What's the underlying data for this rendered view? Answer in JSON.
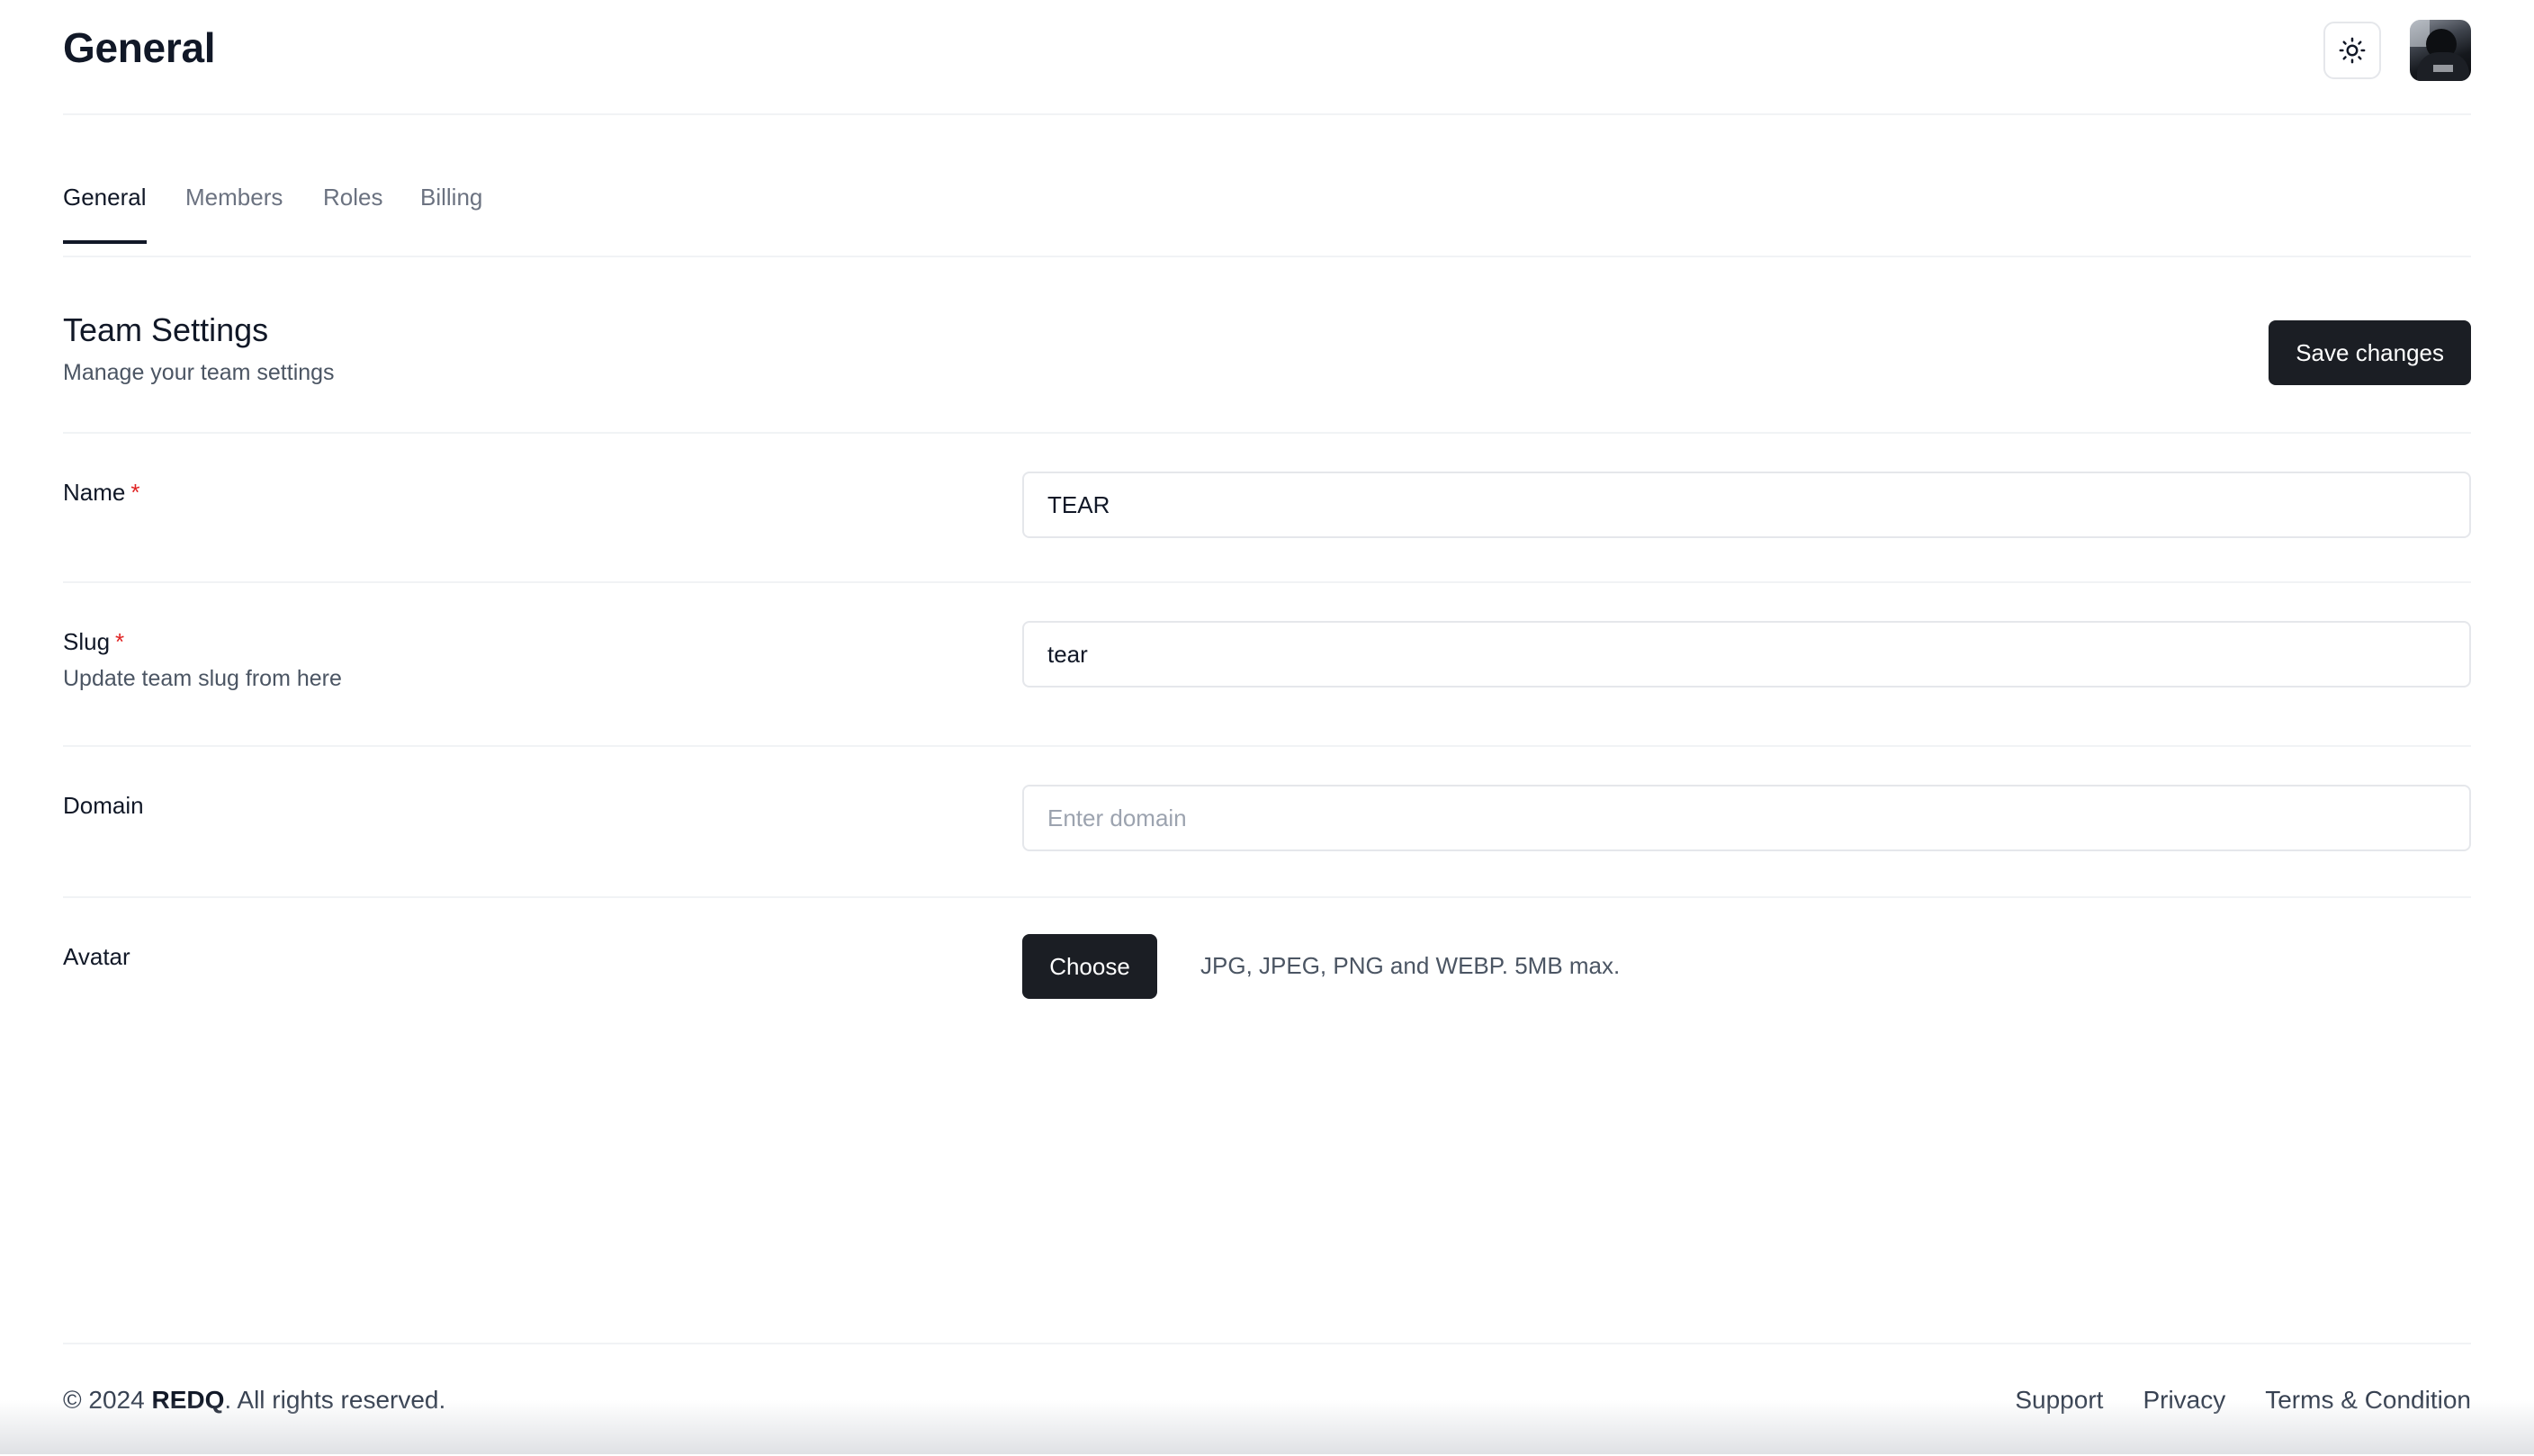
{
  "header": {
    "title": "General",
    "theme_toggle_icon": "sun-icon",
    "avatar_icon": "user-avatar"
  },
  "tabs": [
    {
      "label": "General",
      "active": true
    },
    {
      "label": "Members",
      "active": false
    },
    {
      "label": "Roles",
      "active": false
    },
    {
      "label": "Billing",
      "active": false
    }
  ],
  "section": {
    "title": "Team Settings",
    "subtitle": "Manage your team settings",
    "save_label": "Save changes"
  },
  "form": {
    "name": {
      "label": "Name",
      "required_mark": "*",
      "value": "TEAR",
      "placeholder": ""
    },
    "slug": {
      "label": "Slug",
      "required_mark": "*",
      "help": "Update team slug from here",
      "value": "tear",
      "placeholder": ""
    },
    "domain": {
      "label": "Domain",
      "value": "",
      "placeholder": "Enter domain"
    },
    "avatar": {
      "label": "Avatar",
      "choose_label": "Choose",
      "hint": "JPG, JPEG, PNG and WEBP. 5MB max."
    }
  },
  "footer": {
    "copyright_prefix": "© 2024 ",
    "brand": "REDQ",
    "copyright_suffix": ". All rights reserved.",
    "links": [
      "Support",
      "Privacy",
      "Terms & Condition"
    ]
  },
  "colors": {
    "primary_button": "#1b1e24",
    "required": "#e02424",
    "border": "#e5e7eb"
  }
}
